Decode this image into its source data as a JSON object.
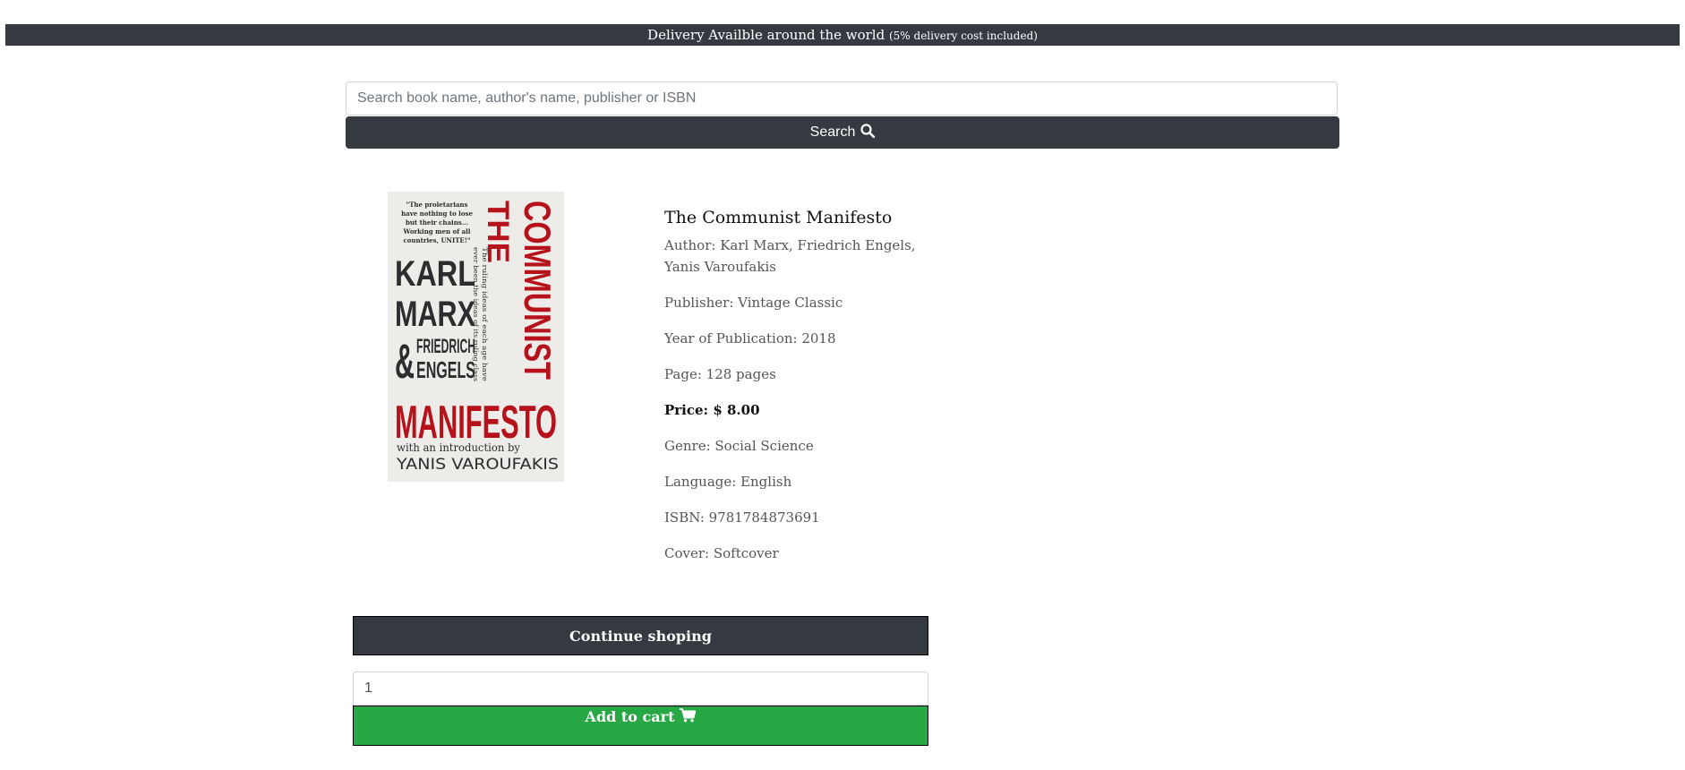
{
  "banner": {
    "main": "Delivery Availble around the world",
    "note": "(5% delivery cost included)"
  },
  "search": {
    "placeholder": "Search book name, author's name, publisher or ISBN",
    "button_label": "Search",
    "icon": "search-icon"
  },
  "cover": {
    "quote": "\"The proletarians have nothing to lose but their chains... Working men of all countries, UNITE!\"",
    "the": "THE",
    "communist": "COMMUNIST",
    "tagline": "The ruling ideas of each age have ever been the ideas of its ruling class",
    "karl": "KARL",
    "marx": "MARX",
    "amp": "&",
    "friedrich": "FRIEDRICH",
    "engels": "ENGELS",
    "manifesto": "MANIFESTO",
    "intro": "with an introduction by",
    "introducer": "YANIS VAROUFAKIS",
    "accent_color": "#b5121b",
    "text_color": "#2d2d2d"
  },
  "book": {
    "title": "The Communist Manifesto",
    "author_line1": "Author: Karl Marx, Friedrich Engels,",
    "author_line2": "Yanis Varoufakis",
    "publisher": "Publisher: Vintage Classic",
    "year": "Year of Publication: 2018",
    "pages": "Page: 128 pages",
    "price": "Price: $ 8.00",
    "genre": "Genre: Social Science",
    "language": "Language: English",
    "isbn": "ISBN: 9781784873691",
    "cover_type": "Cover: Softcover"
  },
  "actions": {
    "continue_label": "Continue shoping",
    "quantity": "1",
    "add_to_cart_label": "Add to cart",
    "cart_icon": "cart-icon"
  },
  "colors": {
    "dark": "#343a40",
    "success": "#28a745"
  }
}
